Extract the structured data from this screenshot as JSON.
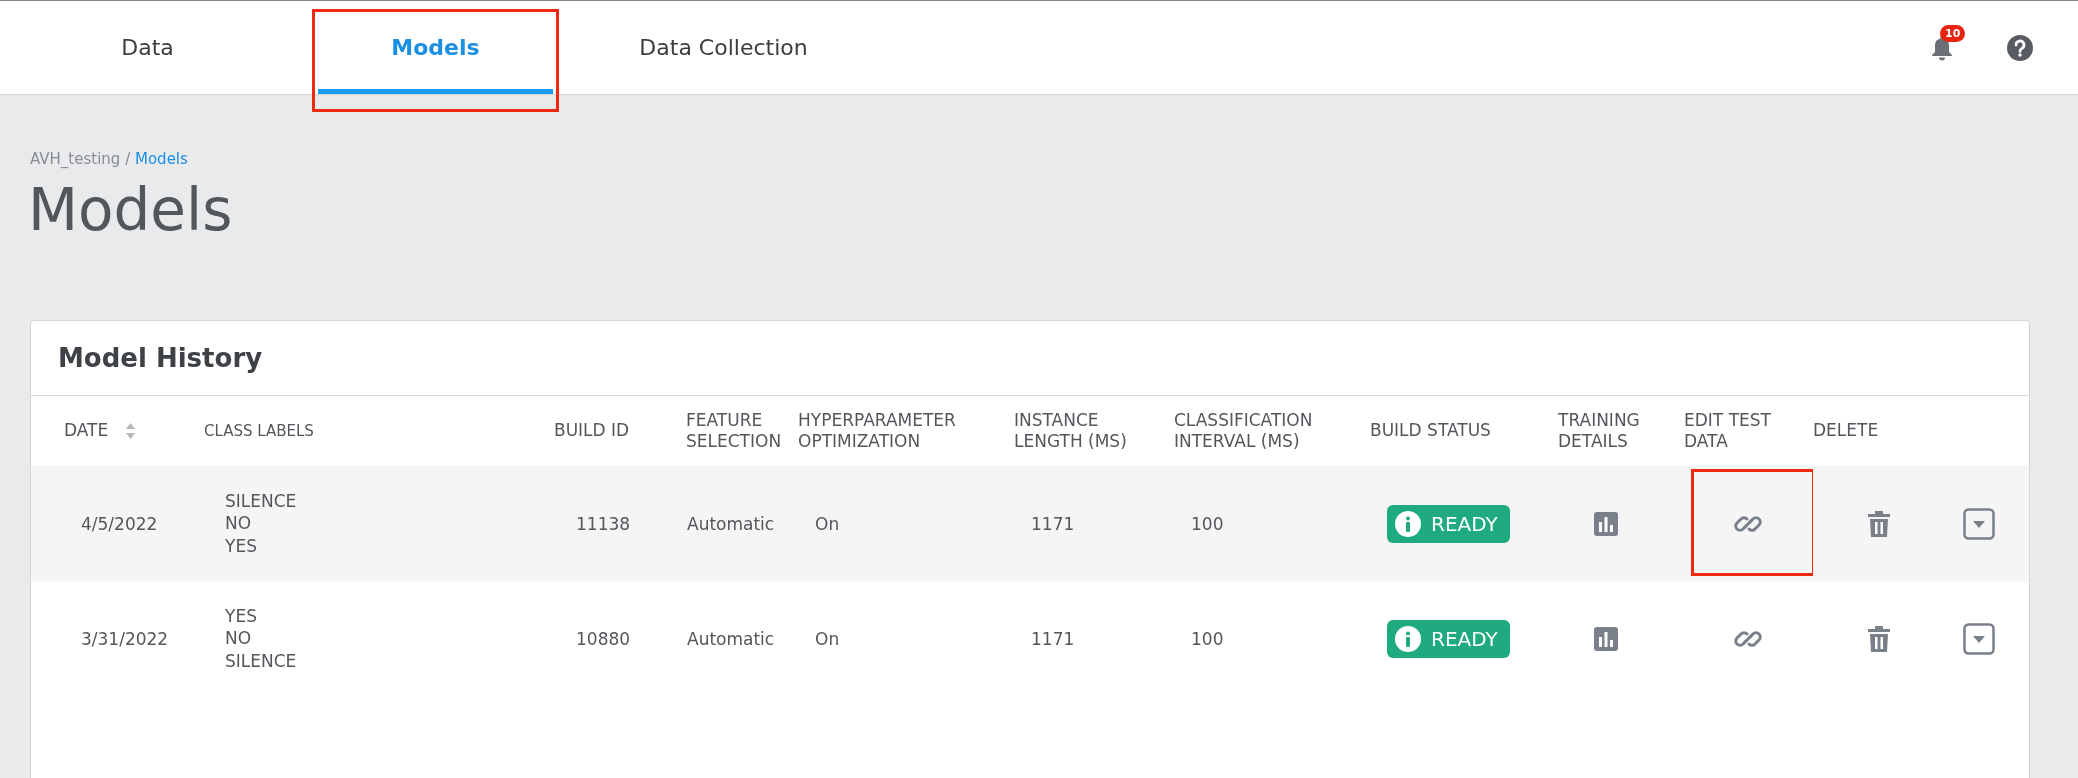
{
  "nav": {
    "tabs": [
      {
        "label": "Data",
        "selected": false,
        "highlighted": false
      },
      {
        "label": "Models",
        "selected": true,
        "highlighted": true
      },
      {
        "label": "Data Collection",
        "selected": false,
        "highlighted": false
      }
    ],
    "notification_count": "10"
  },
  "breadcrumb": {
    "project": "AVH_testing",
    "separator": "/",
    "current": "Models"
  },
  "page_title": "Models",
  "model_history": {
    "title": "Model History",
    "columns": [
      {
        "label": "DATE",
        "sortable": true
      },
      {
        "label": "CLASS LABELS",
        "sortable": false
      },
      {
        "label": "BUILD ID",
        "sortable": false
      },
      {
        "label": "FEATURE SELECTION",
        "sortable": false
      },
      {
        "label": "HYPERPARAMETER OPTIMIZATION",
        "sortable": false
      },
      {
        "label": "INSTANCE LENGTH (MS)",
        "sortable": false
      },
      {
        "label": "CLASSIFICATION INTERVAL (MS)",
        "sortable": false
      },
      {
        "label": "BUILD STATUS",
        "sortable": false
      },
      {
        "label": "TRAINING DETAILS",
        "sortable": false
      },
      {
        "label": "EDIT TEST DATA",
        "sortable": false
      },
      {
        "label": "DELETE",
        "sortable": false
      }
    ],
    "rows": [
      {
        "date": "4/5/2022",
        "class_labels": [
          "SILENCE",
          "NO",
          "YES"
        ],
        "build_id": "11138",
        "feature_selection": "Automatic",
        "hyperparameter_optimization": "On",
        "instance_length": "1171",
        "classification_interval": "100",
        "build_status": "READY",
        "edit_highlighted": true
      },
      {
        "date": "3/31/2022",
        "class_labels": [
          "YES",
          "NO",
          "SILENCE"
        ],
        "build_id": "10880",
        "feature_selection": "Automatic",
        "hyperparameter_optimization": "On",
        "instance_length": "1171",
        "classification_interval": "100",
        "build_status": "READY",
        "edit_highlighted": false
      }
    ]
  }
}
